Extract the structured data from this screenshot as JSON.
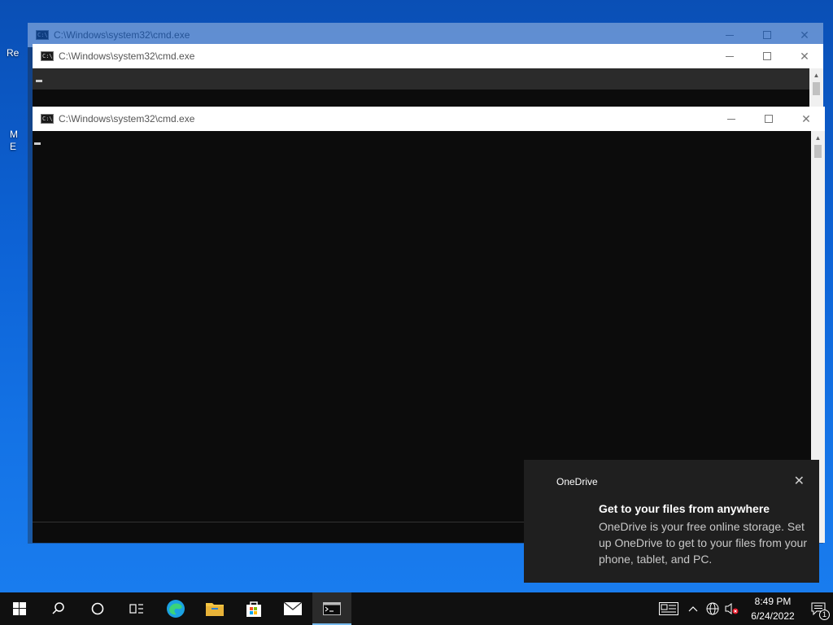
{
  "desktop": {
    "partial_labels": [
      "Re",
      "M",
      "E"
    ]
  },
  "windows": [
    {
      "title": "C:\\Windows\\system32\\cmd.exe"
    },
    {
      "title": "C:\\Windows\\system32\\cmd.exe"
    },
    {
      "title": "C:\\Windows\\system32\\cmd.exe"
    }
  ],
  "toast": {
    "app_name": "OneDrive",
    "heading": "Get to your files from anywhere",
    "body": "OneDrive is your free online storage. Set up OneDrive to get to your files from your phone, tablet, and PC.",
    "close_glyph": "✕"
  },
  "taskbar": {
    "apps": [
      "start",
      "search",
      "cortana",
      "task-view",
      "edge",
      "file-explorer",
      "store",
      "mail",
      "command-prompt"
    ],
    "clock_time": "8:49 PM",
    "clock_date": "6/24/2022",
    "notification_count": "1"
  },
  "colors": {
    "accent": "#76b9ed",
    "desktop": "#0d63d6",
    "console_bg": "#0c0c0c"
  }
}
